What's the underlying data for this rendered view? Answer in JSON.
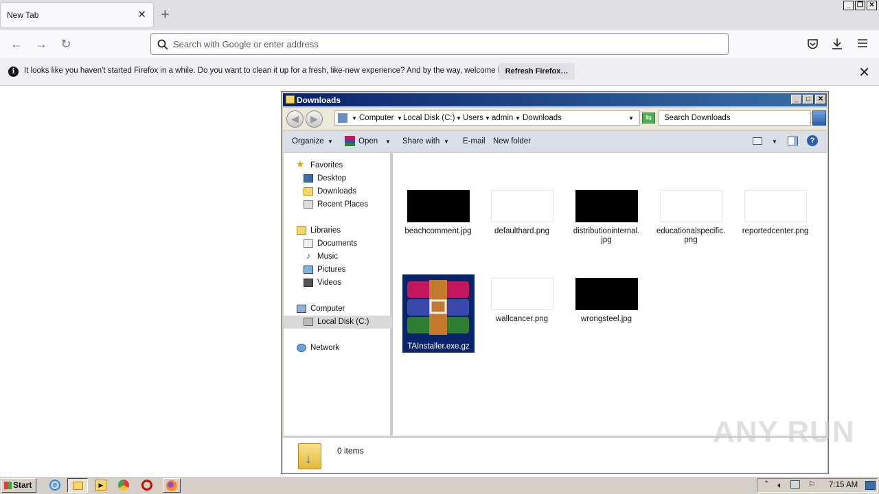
{
  "browser": {
    "tab_title": "New Tab",
    "url_placeholder": "Search with Google or enter address",
    "notification_text": "It looks like you haven't started Firefox in a while. Do you want to clean it up for a fresh, like-new experience? And by the way, welcome back!",
    "notification_button": "Refresh Firefox…"
  },
  "explorer": {
    "title": "Downloads",
    "breadcrumb": [
      "Computer",
      "Local Disk (C:)",
      "Users",
      "admin",
      "Downloads"
    ],
    "search_placeholder": "Search Downloads",
    "toolbar": {
      "organize": "Organize",
      "open": "Open",
      "share_with": "Share with",
      "email": "E-mail",
      "new_folder": "New folder"
    },
    "nav": {
      "favorites": "Favorites",
      "desktop": "Desktop",
      "downloads": "Downloads",
      "recent_places": "Recent Places",
      "libraries": "Libraries",
      "documents": "Documents",
      "music": "Music",
      "pictures": "Pictures",
      "videos": "Videos",
      "computer": "Computer",
      "local_disk": "Local Disk (C:)",
      "network": "Network"
    },
    "files": [
      {
        "line1": "beachcomment.jpg",
        "line2": ""
      },
      {
        "line1": "defaulthard.png",
        "line2": ""
      },
      {
        "line1": "distributioninternal.",
        "line2": "jpg"
      },
      {
        "line1": "educationalspecific.",
        "line2": "png"
      },
      {
        "line1": "reportedcenter.png",
        "line2": ""
      },
      {
        "line1": "TAInstaller.exe.gz",
        "line2": ""
      },
      {
        "line1": "wallcancer.png",
        "line2": ""
      },
      {
        "line1": "wrongsteel.jpg",
        "line2": ""
      }
    ],
    "status": "0 items"
  },
  "taskbar": {
    "start": "Start",
    "clock": "7:15 AM"
  },
  "watermark": "ANY RUN",
  "colors": {
    "title_bar": "#0a246a",
    "selection": "#0a246a"
  }
}
